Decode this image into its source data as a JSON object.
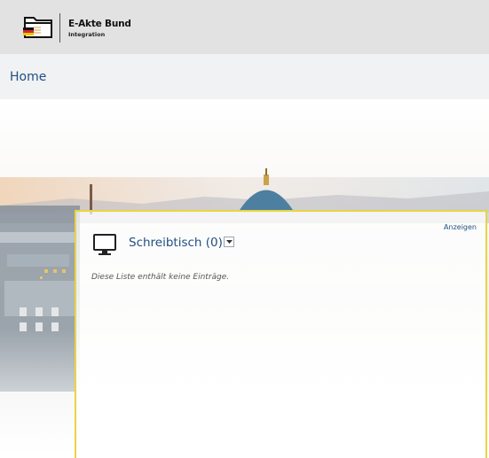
{
  "app": {
    "title": "E-Akte Bund",
    "subtitle": "Integration",
    "logo_icon": "folder-flag-icon"
  },
  "breadcrumb": {
    "home_label": "Home"
  },
  "panel": {
    "title": "Schreibtisch (0)",
    "show_link_label": "Anzeigen",
    "empty_text": "Diese Liste enthält keine Einträge.",
    "icon": "monitor-icon",
    "accent_color": "#e8d541"
  },
  "colors": {
    "topbar_bg": "#e2e2e2",
    "link_blue": "#1f4f82"
  }
}
